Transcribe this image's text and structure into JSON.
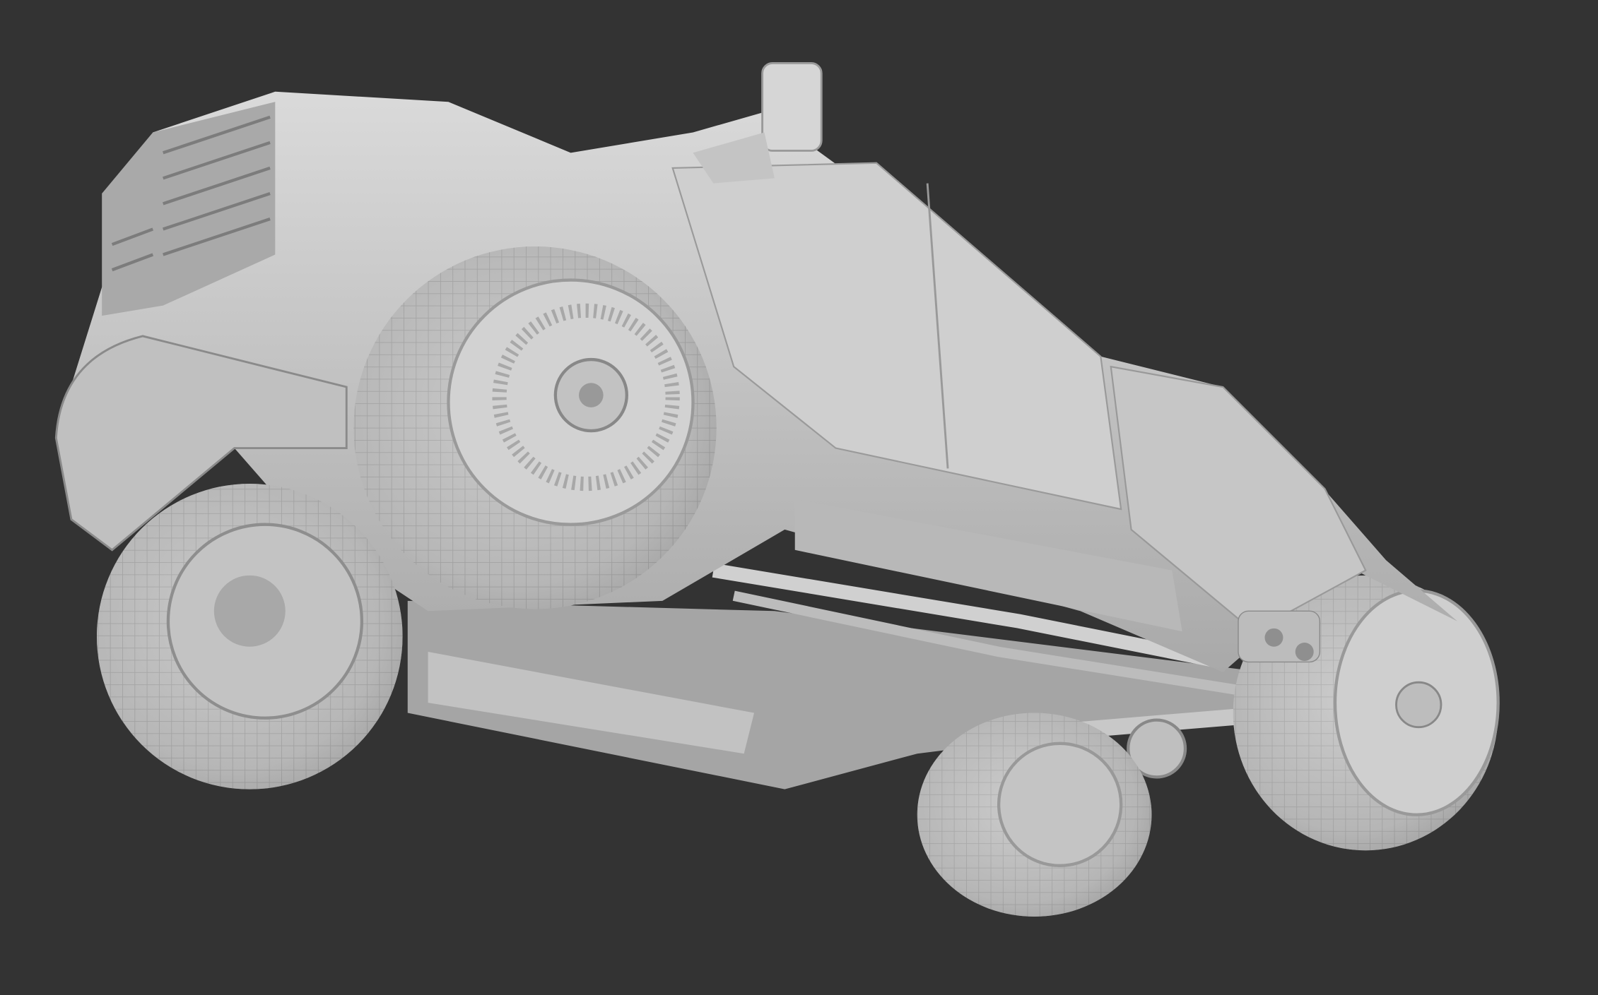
{
  "render": {
    "colors": {
      "background": "#333333",
      "clay": "#c9c9c9",
      "clay_light": "#dcdcdc",
      "clay_shadow": "#8e8e8e",
      "tire": "#b4b4b4"
    }
  }
}
